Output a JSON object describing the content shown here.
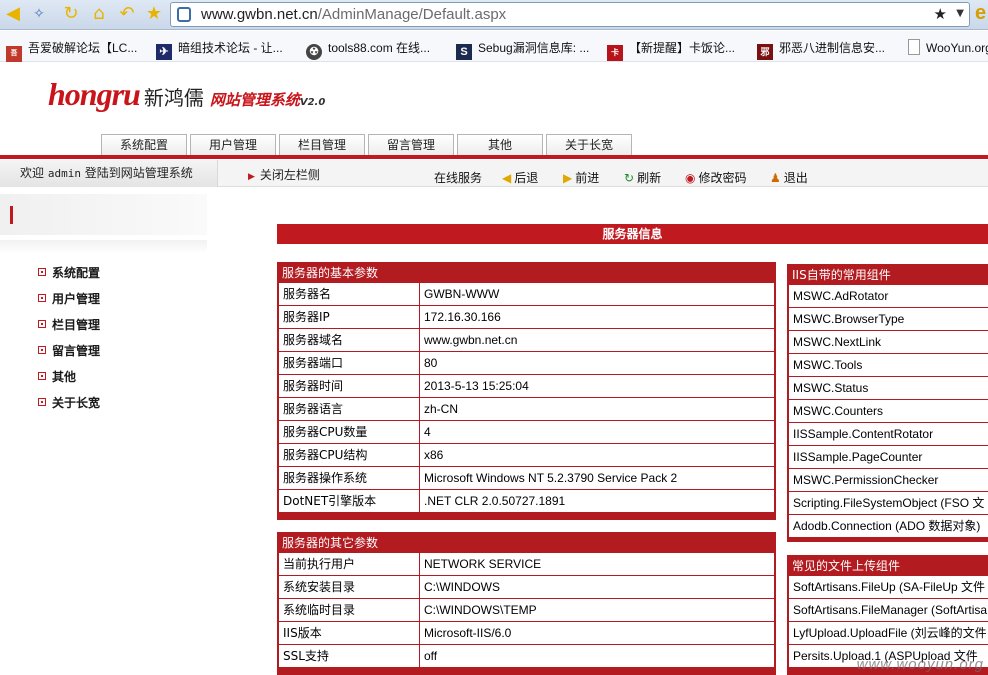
{
  "browser": {
    "url_host": "www.gwbn.net.cn",
    "url_path": "/AdminManage/Default.aspx",
    "bookmarks": [
      {
        "label": "吾爱破解论坛【LC...",
        "color": "#c0392b",
        "icon": "52pojie-icon"
      },
      {
        "label": "暗组技术论坛 - 让...",
        "color": "#1f2a6b",
        "icon": "darkgroup-icon"
      },
      {
        "label": "tools88.com 在线...",
        "color": "#444444",
        "icon": "radiation-icon"
      },
      {
        "label": "Sebug漏洞信息库: ...",
        "color": "#1b2b50",
        "icon": "sebug-icon"
      },
      {
        "label": "【新提醒】卡饭论...",
        "color": "#b8131a",
        "icon": "kafan-icon"
      },
      {
        "label": "邪恶八进制信息安...",
        "color": "#7a1010",
        "icon": "eviloctal-icon"
      },
      {
        "label": "WooYun.org",
        "color": "#dddddd",
        "icon": "page-icon"
      }
    ]
  },
  "logo": {
    "word": "hongru",
    "cn": "新鸿儒",
    "sys": "网站管理系统",
    "version": "V2.0"
  },
  "top_tabs": [
    "系统配置",
    "用户管理",
    "栏目管理",
    "留言管理",
    "其他",
    "关于长宽"
  ],
  "status": {
    "welcome_prefix": "欢迎",
    "username": "admin",
    "welcome_suffix": "登陆到网站管理系统",
    "close_left": "关闭左栏侧"
  },
  "toolbar": {
    "online": "在线服务",
    "back": "后退",
    "forward": "前进",
    "refresh": "刷新",
    "change_password": "修改密码",
    "logout": "退出"
  },
  "sidebar": {
    "items": [
      "系统配置",
      "用户管理",
      "栏目管理",
      "留言管理",
      "其他",
      "关于长宽"
    ]
  },
  "main": {
    "title": "服务器信息",
    "basic": {
      "title": "服务器的基本参数",
      "rows": [
        [
          "服务器名",
          "GWBN-WWW"
        ],
        [
          "服务器IP",
          "172.16.30.166"
        ],
        [
          "服务器域名",
          "www.gwbn.net.cn"
        ],
        [
          "服务器端口",
          "80"
        ],
        [
          "服务器时间",
          "2013-5-13 15:25:04"
        ],
        [
          "服务器语言",
          "zh-CN"
        ],
        [
          "服务器CPU数量",
          "4"
        ],
        [
          "服务器CPU结构",
          "x86"
        ],
        [
          "服务器操作系统",
          "Microsoft Windows NT 5.2.3790 Service Pack 2"
        ],
        [
          "DotNET引擎版本",
          ".NET CLR 2.0.50727.1891"
        ]
      ]
    },
    "other": {
      "title": "服务器的其它参数",
      "rows": [
        [
          "当前执行用户",
          "NETWORK SERVICE"
        ],
        [
          "系统安装目录",
          "C:\\WINDOWS"
        ],
        [
          "系统临时目录",
          "C:\\WINDOWS\\TEMP"
        ],
        [
          "IIS版本",
          "Microsoft-IIS/6.0"
        ],
        [
          "SSL支持",
          "off"
        ]
      ]
    },
    "iis": {
      "title": "IIS自带的常用组件",
      "rows": [
        "MSWC.AdRotator",
        "MSWC.BrowserType",
        "MSWC.NextLink",
        "MSWC.Tools",
        "MSWC.Status",
        "MSWC.Counters",
        "IISSample.ContentRotator",
        "IISSample.PageCounter",
        "MSWC.PermissionChecker",
        "Scripting.FileSystemObject (FSO 文",
        "Adodb.Connection (ADO 数据对象)"
      ]
    },
    "upload": {
      "title": "常见的文件上传组件",
      "rows": [
        "SoftArtisans.FileUp (SA-FileUp 文件",
        "SoftArtisans.FileManager (SoftArtisa",
        "LyfUpload.UploadFile (刘云峰的文件",
        "Persits.Upload.1 (ASPUpload 文件"
      ]
    }
  },
  "watermark": "www.wooyun.org",
  "colors": {
    "brand_red": "#c01a20",
    "panel_red": "#b21b20"
  }
}
